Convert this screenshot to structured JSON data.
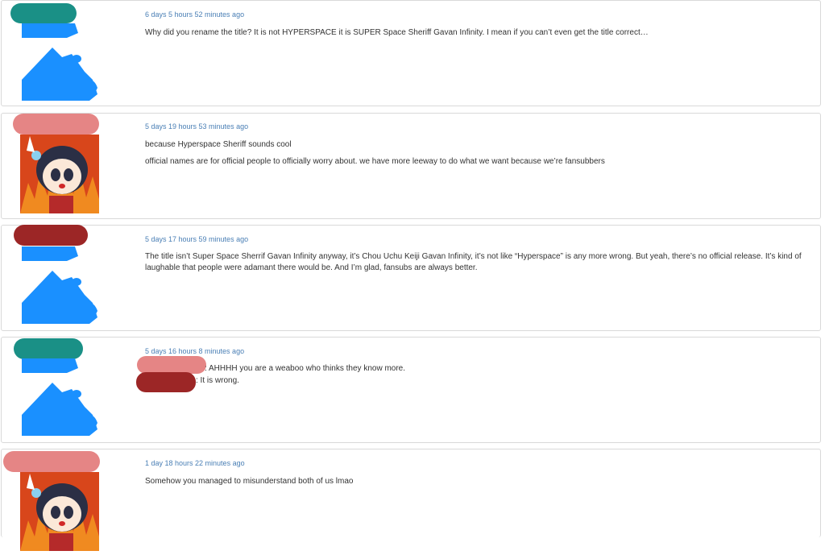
{
  "comments": [
    {
      "timestamp": "6 days 5 hours 52 minutes ago",
      "lines": [
        "Why did you rename the title? It is not HYPERSPACE it is SUPER Space Sheriff Gavan Infinity. I mean if you can’t even get the title correct…"
      ],
      "avatar": "default-blue-avatar",
      "name_redaction_color": "#1a9086"
    },
    {
      "timestamp": "5 days 19 hours 53 minutes ago",
      "lines": [
        "because Hyperspace Sheriff sounds cool",
        "official names are for official people to officially worry about. we have more leeway to do what we want because we’re fansubbers"
      ],
      "avatar": "anime-girl-fire-avatar",
      "name_redaction_color": "#e58585"
    },
    {
      "timestamp": "5 days 17 hours 59 minutes ago",
      "lines": [
        "The title isn’t Super Space Sherrif Gavan Infinity anyway, it’s Chou Uchu Keiji Gavan Infinity, it’s not like “Hyperspace” is any more wrong. But yeah, there’s no official release. It’s kind of laughable that people were adamant there would be. And I’m glad, fansubs are always better."
      ],
      "avatar": "default-blue-avatar",
      "name_redaction_color": "#9c2626"
    },
    {
      "timestamp": "5 days 16 hours 8 minutes ago",
      "lines": [
        ": AHHHH you are a weaboo who thinks they know more.",
        ": It is wrong."
      ],
      "avatar": "default-blue-avatar",
      "name_redaction_color": "#1a9086",
      "mention_colors": [
        "#e58585",
        "#9c2626"
      ]
    },
    {
      "timestamp": "1 day 18 hours 22 minutes ago",
      "lines": [
        "Somehow you managed to misunderstand both of us lmao"
      ],
      "avatar": "anime-girl-fire-avatar",
      "name_redaction_color": "#e58585"
    }
  ]
}
